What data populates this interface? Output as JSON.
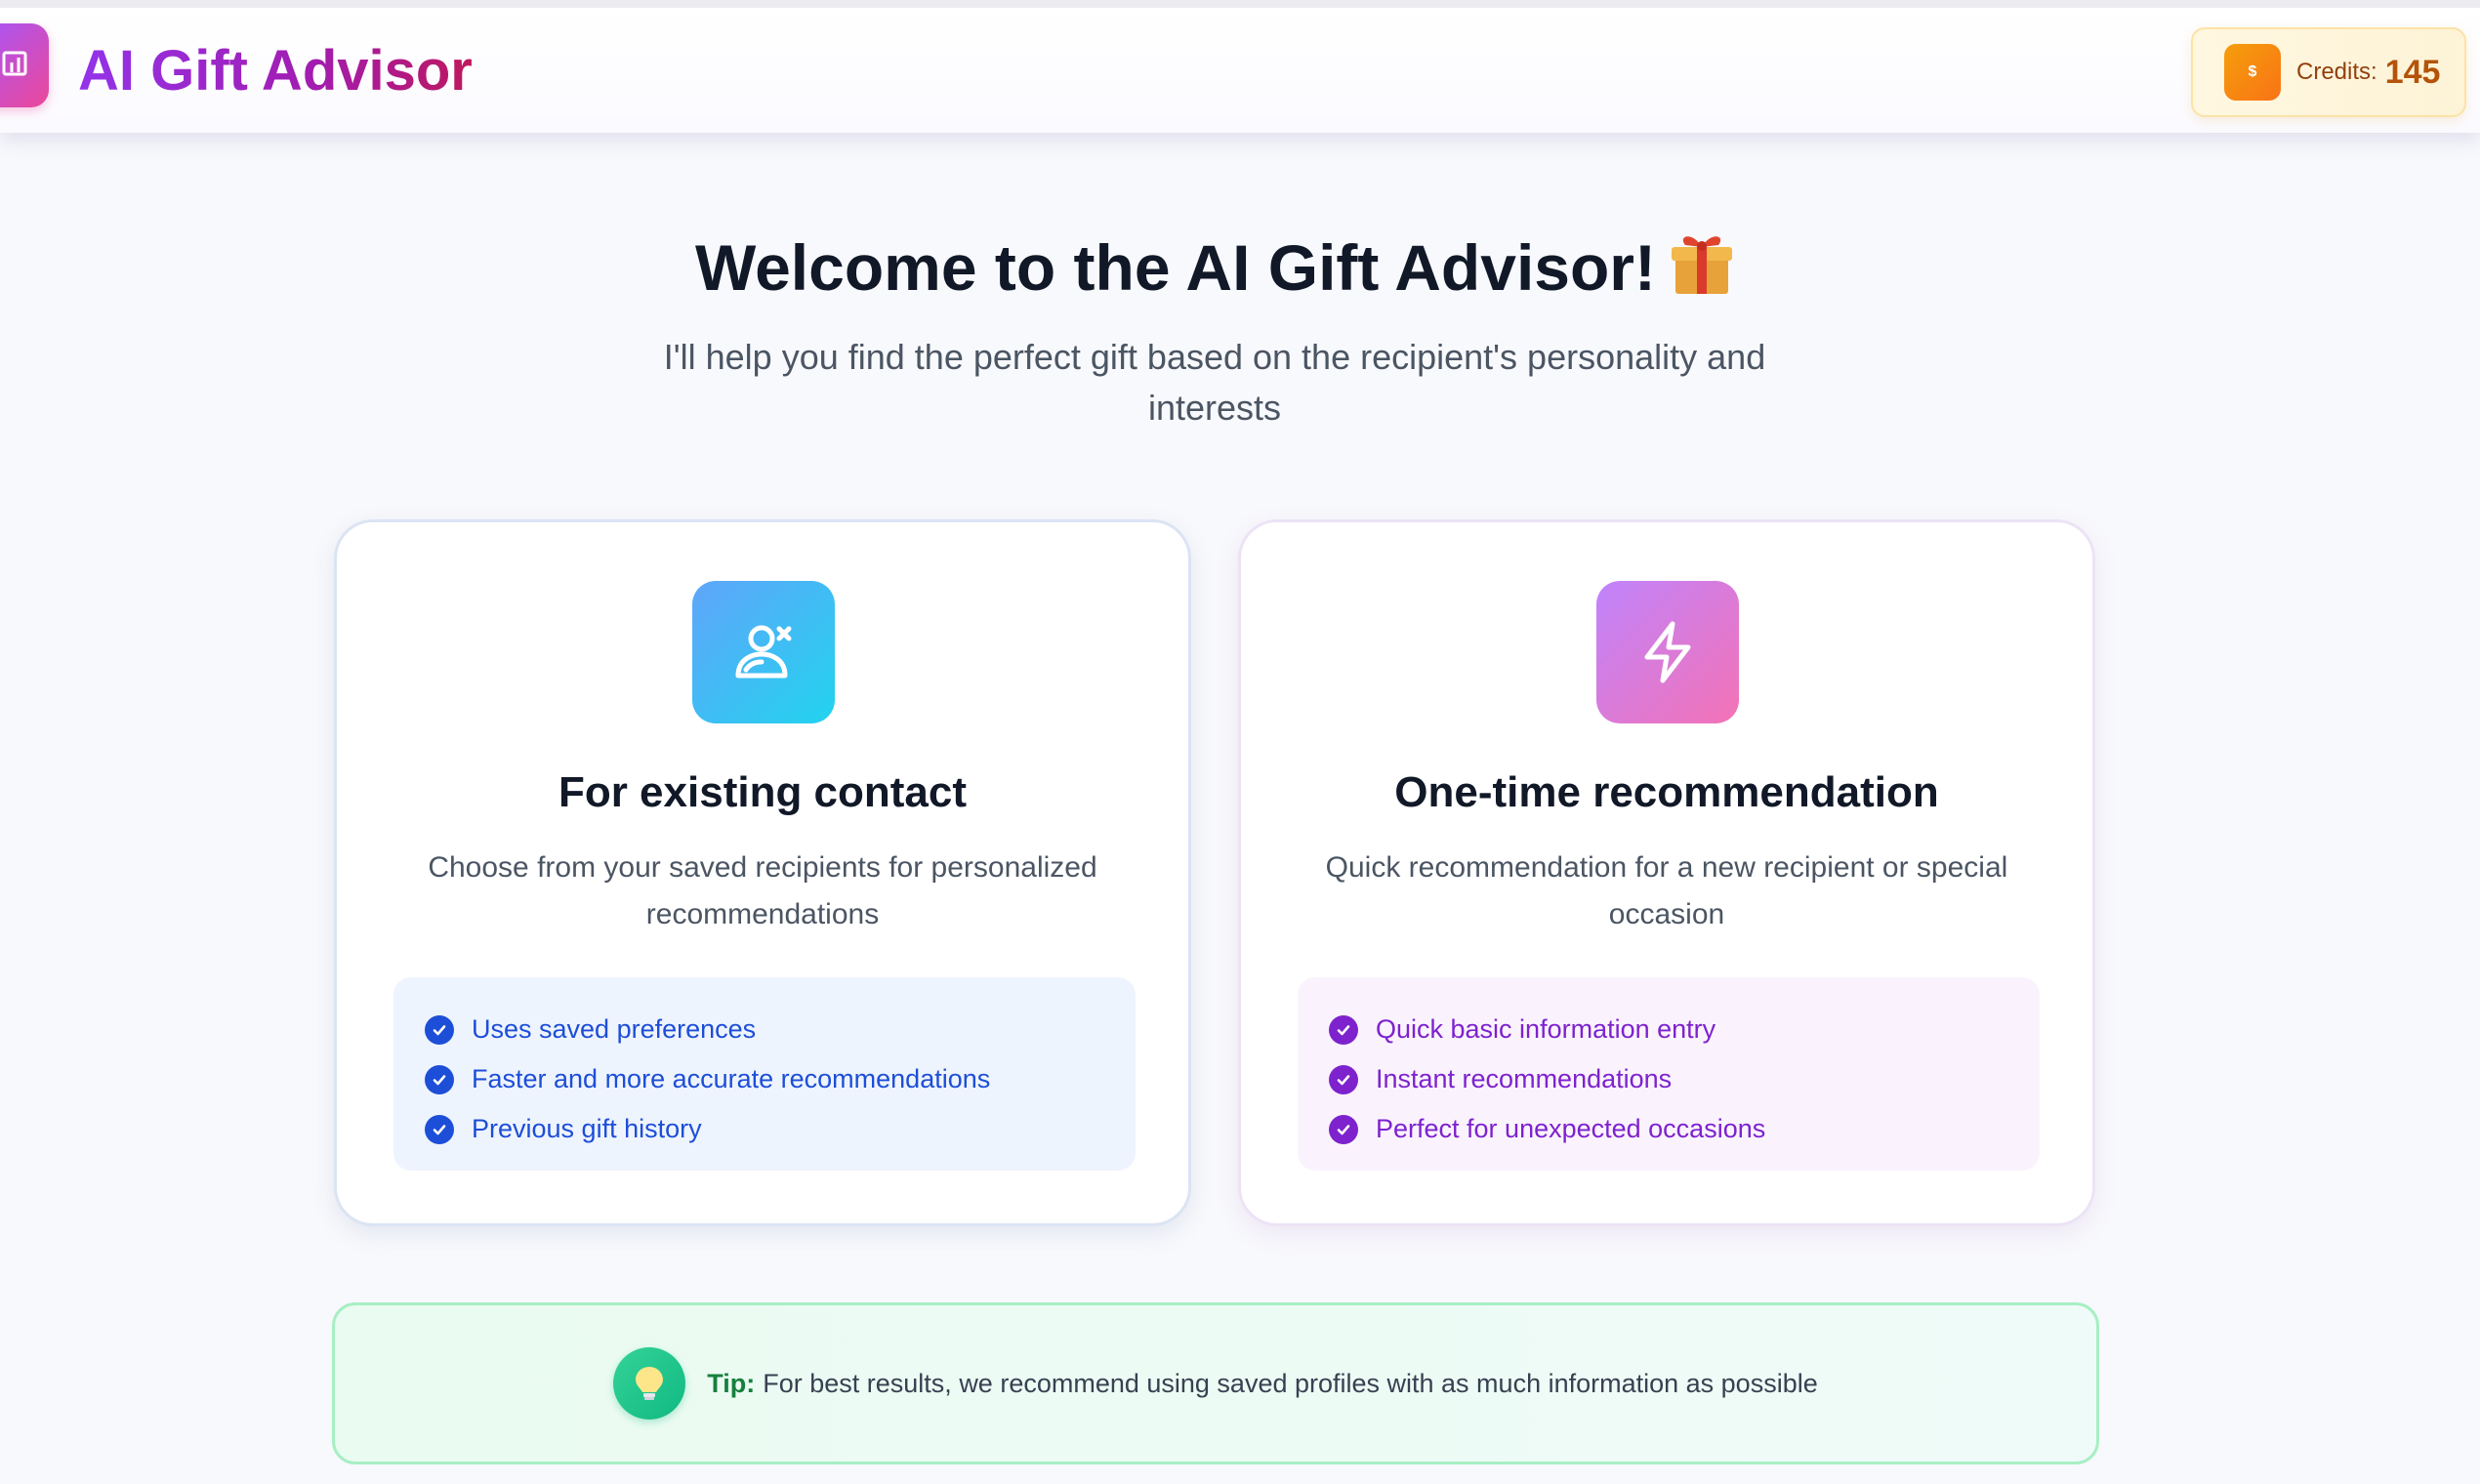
{
  "header": {
    "title": "AI Gift Advisor",
    "logo_icon": "chart-bars-icon",
    "credits": {
      "coin_symbol": "$",
      "label": "Credits:",
      "value": "145"
    }
  },
  "hero": {
    "title": "Welcome to the AI Gift Advisor!",
    "emoji": "🎁",
    "subtitle": "I'll help you find the perfect gift based on the recipient's personality and interests"
  },
  "options": [
    {
      "icon": "contact-person-icon",
      "title": "For existing contact",
      "description": "Choose from your saved recipients for personalized recommendations",
      "features": [
        "Uses saved preferences",
        "Faster and more accurate recommendations",
        "Previous gift history"
      ],
      "accent": "#1d4ed8"
    },
    {
      "icon": "lightning-bolt-icon",
      "title": "One-time recommendation",
      "description": "Quick recommendation for a new recipient or special occasion",
      "features": [
        "Quick basic information entry",
        "Instant recommendations",
        "Perfect for unexpected occasions"
      ],
      "accent": "#7e22ce"
    }
  ],
  "tip": {
    "icon": "lightbulb-icon",
    "label": "Tip:",
    "text": "For best results, we recommend using saved profiles with as much information as possible"
  }
}
